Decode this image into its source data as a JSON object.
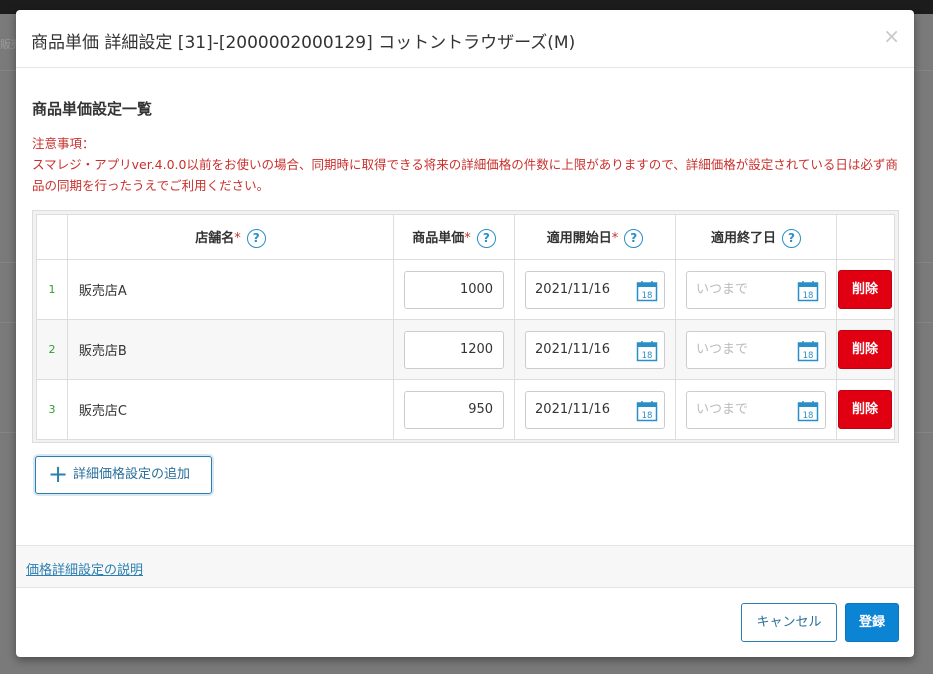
{
  "background": {
    "hint_text": "販売"
  },
  "modal": {
    "title": "商品単価 詳細設定 [31]-[2000002000129] コットントラウザーズ(M)",
    "close_label": "×",
    "section_title": "商品単価設定一覧",
    "notice_heading": "注意事項：",
    "notice_body": "スマレジ・アプリver.4.0.0以前をお使いの場合、同期時に取得できる将来の詳細価格の件数に上限がありますので、詳細価格が設定されている日は必ず商品の同期を行ったうえでご利用ください。",
    "table": {
      "headers": {
        "store": "店舗名",
        "price": "商品単価",
        "start": "適用開始日",
        "end": "適用終了日",
        "required_mark": "*",
        "help_mark": "?"
      },
      "rows": [
        {
          "no": "1",
          "store": "販売店A",
          "price": "1000",
          "start": "2021/11/16",
          "end_placeholder": "いつまで",
          "delete_label": "削除"
        },
        {
          "no": "2",
          "store": "販売店B",
          "price": "1200",
          "start": "2021/11/16",
          "end_placeholder": "いつまで",
          "delete_label": "削除"
        },
        {
          "no": "3",
          "store": "販売店C",
          "price": "950",
          "start": "2021/11/16",
          "end_placeholder": "いつまで",
          "delete_label": "削除"
        }
      ],
      "calendar_day": "18"
    },
    "add_button": {
      "icon": "plus-icon",
      "label": "詳細価格設定の追加"
    },
    "info_link": "価格詳細設定の説明",
    "footer": {
      "cancel_label": "キャンセル",
      "submit_label": "登録"
    }
  },
  "colors": {
    "accent": "#0b84d4",
    "danger": "#e00012",
    "notice": "#c9302c",
    "row_number": "#2f9e2f"
  }
}
